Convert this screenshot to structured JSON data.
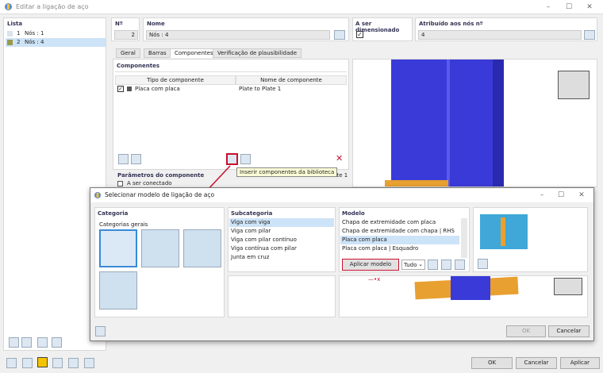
{
  "window": {
    "title": "Editar a ligação de aço",
    "minimize": "–",
    "maximize": "☐",
    "close": "✕"
  },
  "list": {
    "header": "Lista",
    "items": [
      {
        "num": "1",
        "label": "Nós : 1",
        "color": "#d8e4f0"
      },
      {
        "num": "2",
        "label": "Nós : 4",
        "color": "#9a9a4a"
      }
    ]
  },
  "top_fields": {
    "no_label": "Nº",
    "no_value": "2",
    "name_label": "Nome",
    "name_value": "Nós : 4",
    "dimensioned_label": "A ser dimensionado",
    "assigned_label": "Atribuído aos nós nº",
    "assigned_value": "4"
  },
  "tabs": [
    "Geral",
    "Barras",
    "Componentes",
    "Verificação de plausibilidade"
  ],
  "components": {
    "title": "Componentes",
    "col_type": "Tipo de componente",
    "col_name": "Nome de componente",
    "rows": [
      {
        "type": "Placa com placa",
        "name": "Plate to Plate 1"
      }
    ]
  },
  "params": {
    "title": "Parâmetros do componente",
    "tail": "Plate 1",
    "item": "A ser conectado"
  },
  "tooltip": "Inserir componentes da biblioteca",
  "dialog": {
    "title": "Selecionar modelo de ligação de aço",
    "category_title": "Categoria",
    "category_sub": "Categorias gerais",
    "subcategory_title": "Subcategoria",
    "subcategories": [
      "Viga com viga",
      "Viga com pilar",
      "Viga com pilar contínuo",
      "Viga contínua com pilar",
      "Junta em cruz"
    ],
    "model_title": "Modelo",
    "models": [
      "Chapa de extremidade com placa",
      "Chapa de extremidade com chapa | RHS",
      "Placa com placa",
      "Placa com placa | Esquadro"
    ],
    "apply_button": "Aplicar modelo",
    "filter_value": "Tudo",
    "ok": "OK",
    "cancel": "Cancelar"
  },
  "footer": {
    "ok": "OK",
    "cancel": "Cancelar",
    "apply": "Aplicar"
  },
  "colors": {
    "accent": "#c8102e",
    "selection": "#cde3f7",
    "beam_blue": "#3a3ad8",
    "plate_orange": "#e8a030"
  }
}
